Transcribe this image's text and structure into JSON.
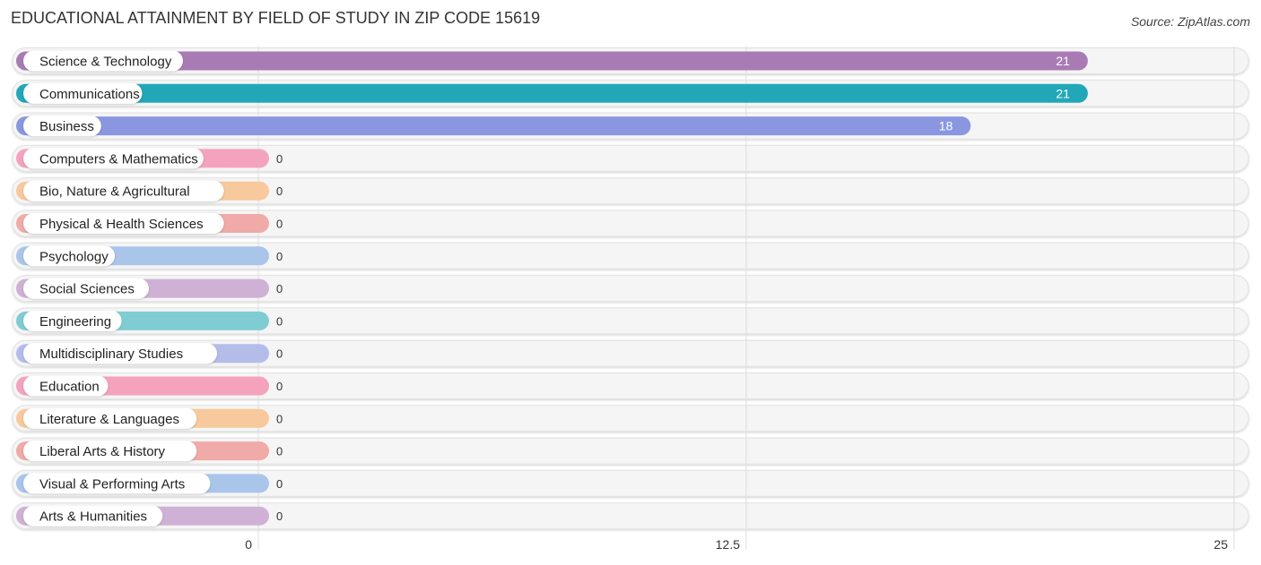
{
  "chart_data": {
    "type": "bar",
    "orientation": "horizontal",
    "title": "EDUCATIONAL ATTAINMENT BY FIELD OF STUDY IN ZIP CODE 15619",
    "source": "Source: ZipAtlas.com",
    "xlabel": "",
    "ylabel": "",
    "xlim": [
      0,
      25
    ],
    "x_ticks": [
      "0",
      "12.5",
      "25"
    ],
    "x_tick_values": [
      0,
      12.5,
      25
    ],
    "grid": true,
    "categories": [
      "Science & Technology",
      "Communications",
      "Business",
      "Computers & Mathematics",
      "Bio, Nature & Agricultural",
      "Physical & Health Sciences",
      "Psychology",
      "Social Sciences",
      "Engineering",
      "Multidisciplinary Studies",
      "Education",
      "Literature & Languages",
      "Liberal Arts & History",
      "Visual & Performing Arts",
      "Arts & Humanities"
    ],
    "values": [
      21,
      21,
      18,
      0,
      0,
      0,
      0,
      0,
      0,
      0,
      0,
      0,
      0,
      0,
      0
    ],
    "value_labels": [
      "21",
      "21",
      "18",
      "0",
      "0",
      "0",
      "0",
      "0",
      "0",
      "0",
      "0",
      "0",
      "0",
      "0",
      "0"
    ],
    "colors": [
      "#a97bb5",
      "#22a7b8",
      "#8a97e0",
      "#f4a3bf",
      "#f8c99c",
      "#f0aaa8",
      "#a9c6ea",
      "#cfb1d6",
      "#7fcdd2",
      "#b4bdea",
      "#f5a3bc",
      "#f8c99c",
      "#f0aaa8",
      "#a9c6ea",
      "#cfb1d6"
    ]
  }
}
